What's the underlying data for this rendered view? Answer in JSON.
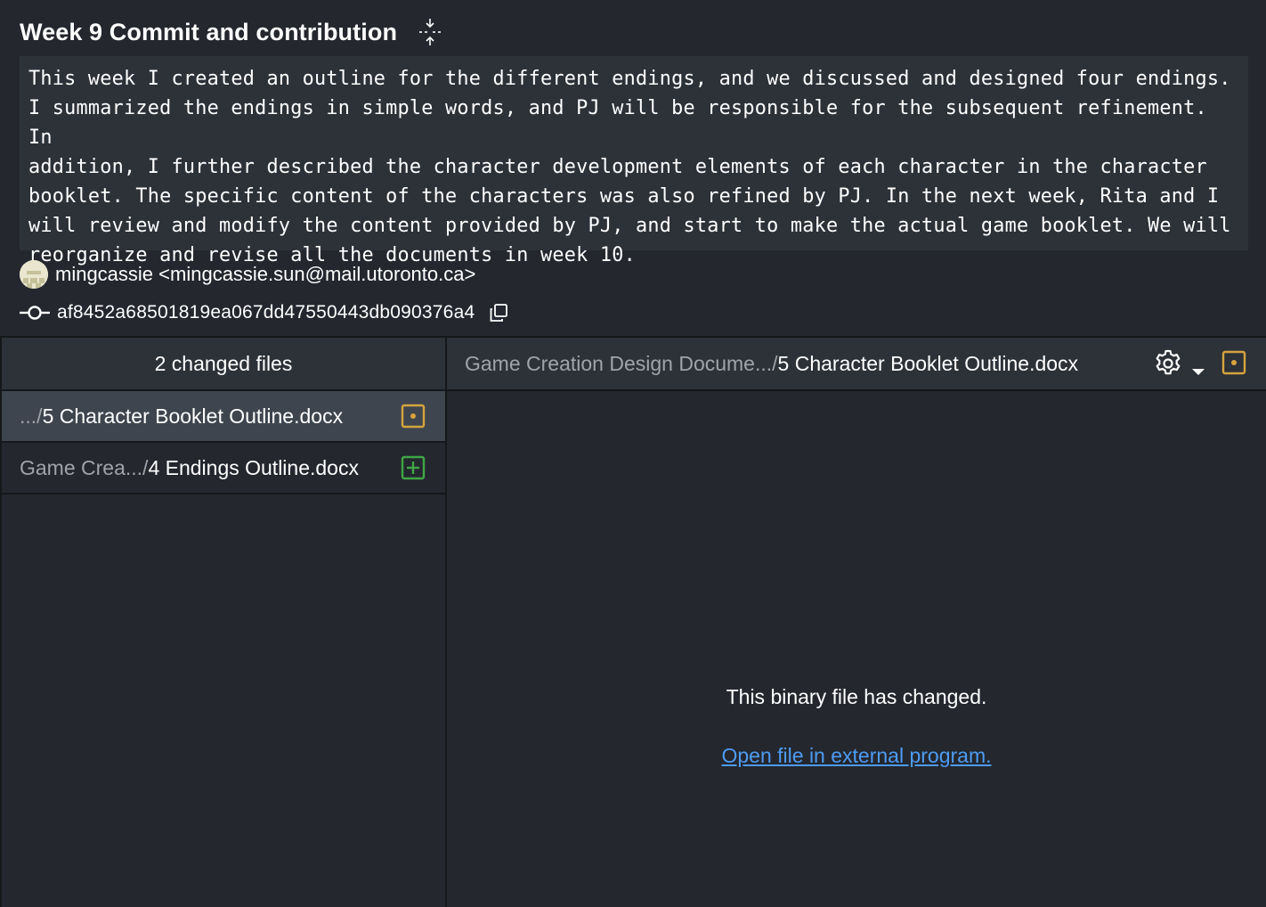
{
  "commit": {
    "title": "Week 9 Commit and contribution",
    "message": "This week I created an outline for the different endings, and we discussed and designed four endings.\nI summarized the endings in simple words, and PJ will be responsible for the subsequent refinement. In\naddition, I further described the character development elements of each character in the character\nbooklet. The specific content of the characters was also refined by PJ. In the next week, Rita and I\nwill review and modify the content provided by PJ, and start to make the actual game booklet. We will\nreorganize and revise all the documents in week 10.",
    "author": "mingcassie <mingcassie.sun@mail.utoronto.ca>",
    "sha": "af8452a68501819ea067dd47550443db090376a4"
  },
  "files_panel": {
    "header": "2 changed files",
    "files": [
      {
        "prefix": ".../",
        "name": "5 Character Booklet Outline.docx",
        "status": "modified"
      },
      {
        "prefix": "Game Crea.../",
        "name": "4 Endings Outline.docx",
        "status": "added"
      }
    ]
  },
  "diff_panel": {
    "path_prefix": "Game Creation Design Docume.../",
    "path_name": "5 Character Booklet Outline.docx",
    "binary_message": "This binary file has changed.",
    "open_link": "Open file in external program."
  },
  "colors": {
    "modified": "#d6a43c",
    "added": "#3fa646",
    "link": "#4d9cf3"
  },
  "icons": [
    "expand-icon",
    "avatar",
    "commit-icon",
    "copy-icon",
    "modified-icon",
    "added-icon",
    "gear-icon",
    "caret-down-icon"
  ]
}
